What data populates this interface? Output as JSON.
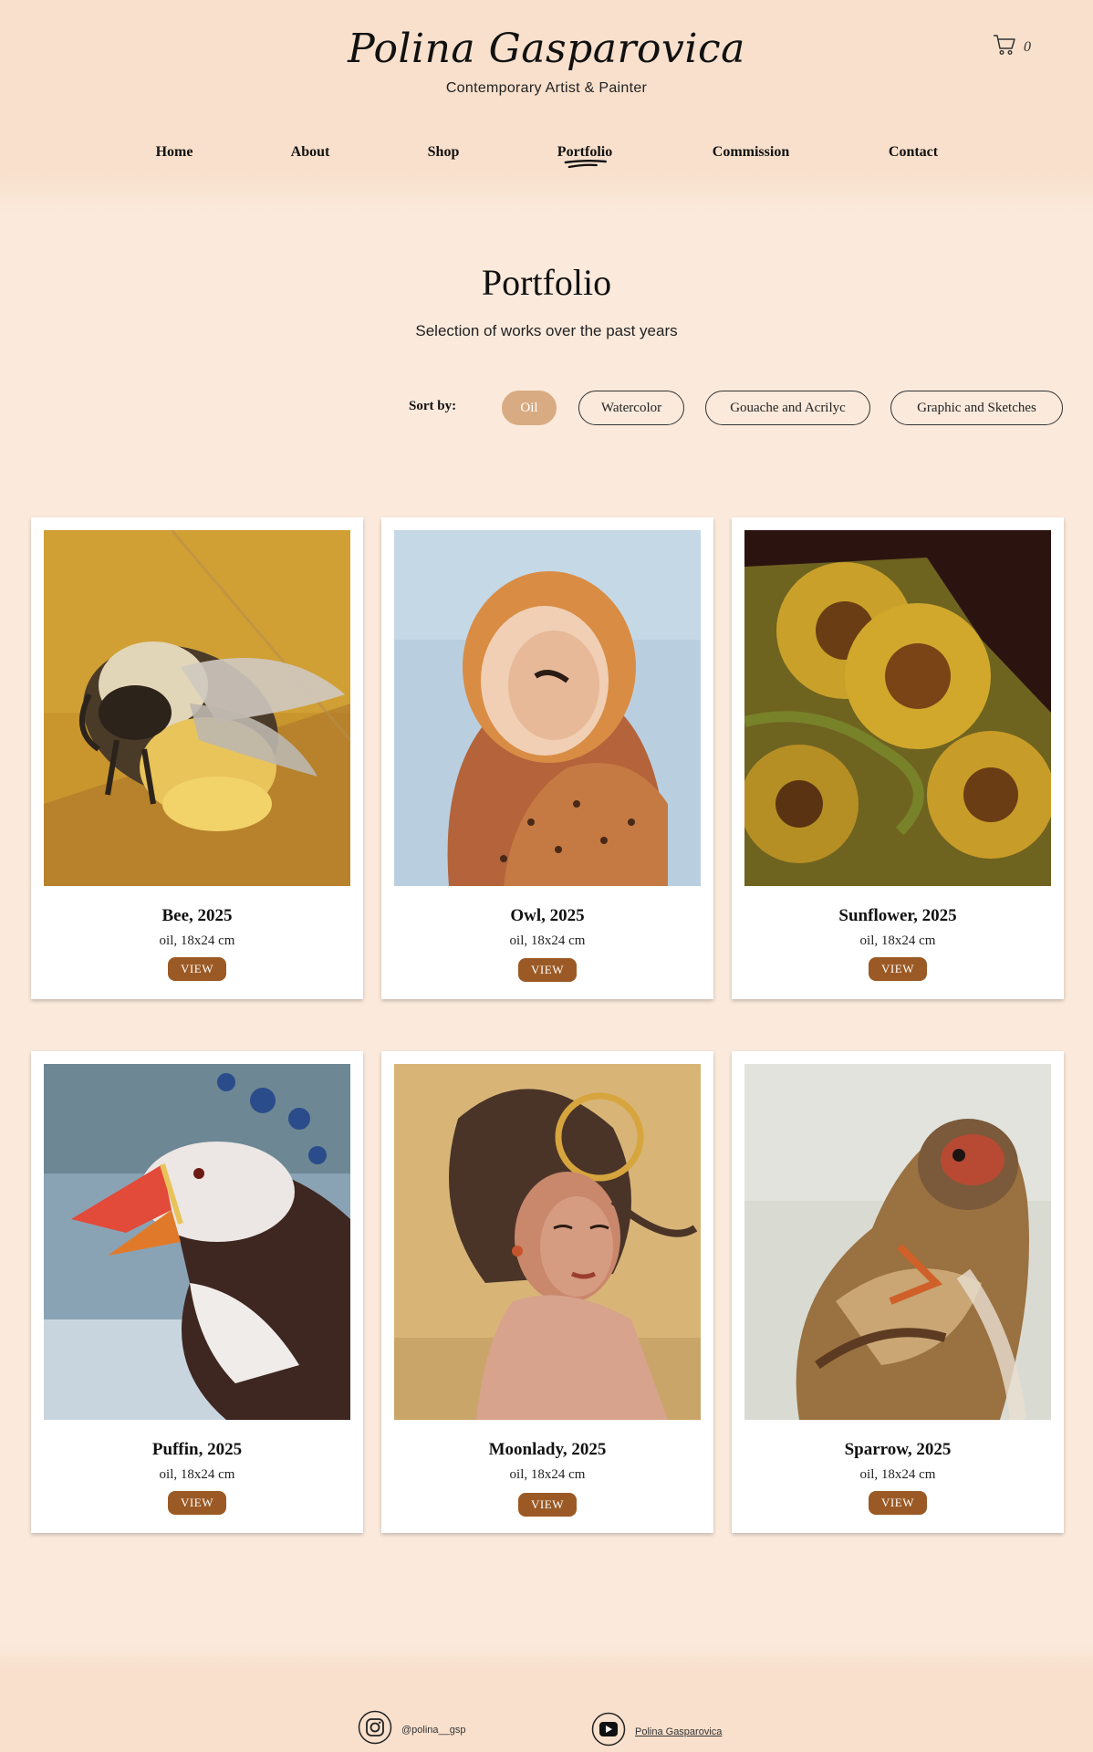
{
  "header": {
    "logo": "Polina Gasparovica",
    "tagline": "Contemporary Artist & Painter",
    "cart_count": "0"
  },
  "nav": {
    "items": [
      "Home",
      "About",
      "Shop",
      "Portfolio",
      "Commission",
      "Contact"
    ],
    "active": "Portfolio"
  },
  "main": {
    "title": "Portfolio",
    "subtitle": "Selection of works over the past years",
    "sort_label": "Sort by:",
    "sort_options": [
      "Oil",
      "Watercolor",
      "Gouache and Acrilyc",
      "Graphic and Sketches"
    ],
    "active_sort": "Oil"
  },
  "artworks": [
    {
      "title": "Bee, 2025",
      "medium": "oil, 18x24 cm",
      "button": "VIEW"
    },
    {
      "title": "Owl, 2025",
      "medium": "oil, 18x24 cm",
      "button": "VIEW"
    },
    {
      "title": "Sunflower, 2025",
      "medium": "oil, 18x24 cm",
      "button": "VIEW"
    },
    {
      "title": "Puffin, 2025",
      "medium": "oil, 18x24 cm",
      "button": "VIEW"
    },
    {
      "title": "Moonlady, 2025",
      "medium": "oil, 18x24 cm",
      "button": "VIEW"
    },
    {
      "title": "Sparrow, 2025",
      "medium": "oil, 18x24 cm",
      "button": "VIEW"
    }
  ],
  "footer": {
    "instagram": "@polina__gsp",
    "youtube": "Polina Gasparovica"
  },
  "colors": {
    "background": "#fbeadc",
    "header": "#f8e0cc",
    "accent_button": "#9b5a25",
    "active_sort": "#d9ab82"
  },
  "icons": [
    "cart-icon",
    "instagram-icon",
    "youtube-icon"
  ]
}
